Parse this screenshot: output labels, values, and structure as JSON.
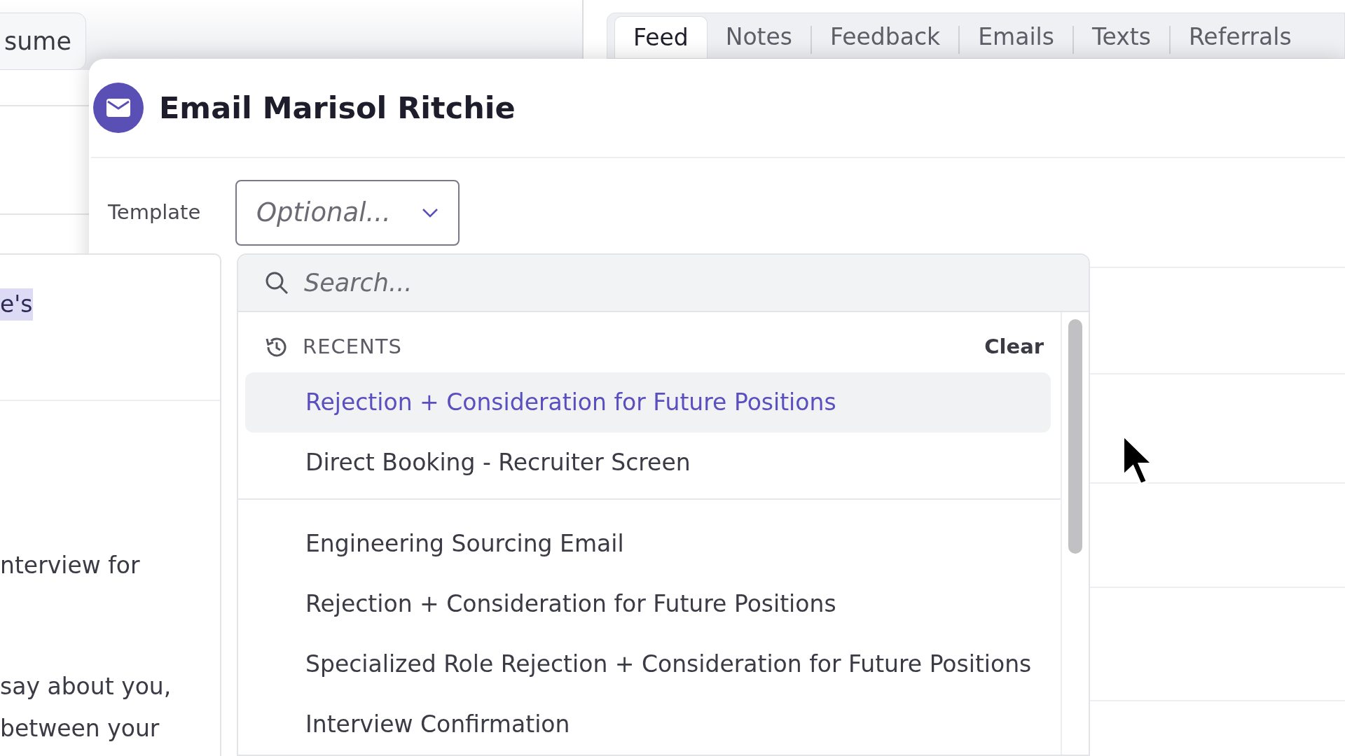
{
  "background": {
    "resume_button": "sume",
    "left_texts": [
      {
        "text": "e's",
        "highlighted": true
      },
      {
        "text": "nterview for",
        "highlighted": false
      },
      {
        "text": "say about you,",
        "highlighted": false
      },
      {
        "text": "between your",
        "highlighted": false
      }
    ]
  },
  "tabs": [
    {
      "label": "Feed",
      "selected": true
    },
    {
      "label": "Notes",
      "selected": false
    },
    {
      "label": "Feedback",
      "selected": false
    },
    {
      "label": "Emails",
      "selected": false
    },
    {
      "label": "Texts",
      "selected": false
    },
    {
      "label": "Referrals",
      "selected": false
    }
  ],
  "modal": {
    "title": "Email Marisol Ritchie",
    "template_label": "Template",
    "template_placeholder": "Optional...",
    "dropdown": {
      "expanded": true,
      "search_placeholder": "Search...",
      "recents_heading": "RECENTS",
      "clear": "Clear",
      "groups": [
        {
          "items": [
            {
              "label": "Rejection + Consideration for Future Positions",
              "selected": true
            },
            {
              "label": "Direct Booking - Recruiter Screen",
              "selected": false
            }
          ]
        },
        {
          "items": [
            {
              "label": "Engineering Sourcing Email",
              "selected": false
            },
            {
              "label": "Rejection + Consideration for Future Positions",
              "selected": false
            },
            {
              "label": "Specialized Role Rejection + Consideration for Future Positions",
              "selected": false
            },
            {
              "label": "Interview Confirmation",
              "selected": false
            }
          ]
        }
      ]
    }
  }
}
